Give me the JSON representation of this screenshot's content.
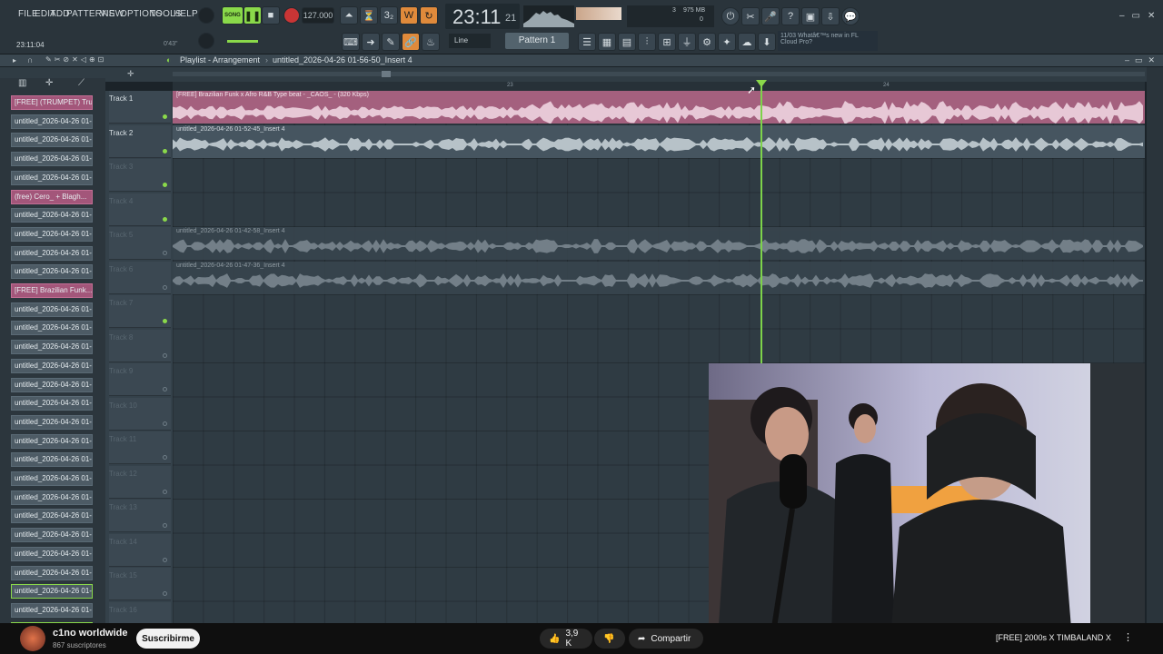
{
  "menu": [
    "FILE",
    "EDIT",
    "ADD",
    "PATTERNS",
    "VIEW",
    "OPTIONS",
    "TOOLS",
    "HELP"
  ],
  "transport": {
    "mode": "SONG",
    "tempo": "127.000",
    "clock": "23:11",
    "clock_small": "21",
    "time_readout": "23:11:04",
    "time_small": "0'43\""
  },
  "stats": {
    "cpu": "3",
    "mem": "975 MB",
    "poly": "0"
  },
  "snap": "Line",
  "pattern": "Pattern 1",
  "news": {
    "date": "11/03",
    "line1": "Whatâ€™s new in FL",
    "line2": "Cloud Pro?"
  },
  "breadcrumb": {
    "root": "Playlist - Arrangement",
    "project": "untitled_2026-04-26 01-56-50_Insert 4"
  },
  "ruler": {
    "m1": "23",
    "m2": "24"
  },
  "patterns": [
    {
      "label": "[FREE] (TRUMPET) Tru...",
      "style": "pink"
    },
    {
      "label": "untitled_2026-04-26 01-...",
      "style": ""
    },
    {
      "label": "untitled_2026-04-26 01-...",
      "style": ""
    },
    {
      "label": "untitled_2026-04-26 01-...",
      "style": ""
    },
    {
      "label": "untitled_2026-04-26 01-...",
      "style": ""
    },
    {
      "label": "(free) Cero_ + Blagh...",
      "style": "pink"
    },
    {
      "label": "untitled_2026-04-26 01-...",
      "style": ""
    },
    {
      "label": "untitled_2026-04-26 01-...",
      "style": ""
    },
    {
      "label": "untitled_2026-04-26 01-...",
      "style": ""
    },
    {
      "label": "untitled_2026-04-26 01-...",
      "style": ""
    },
    {
      "label": "[FREE] Brazilian Funk...",
      "style": "pink"
    },
    {
      "label": "untitled_2026-04-26 01-...",
      "style": ""
    },
    {
      "label": "untitled_2026-04-26 01-...",
      "style": ""
    },
    {
      "label": "untitled_2026-04-26 01-...",
      "style": ""
    },
    {
      "label": "untitled_2026-04-26 01-...",
      "style": ""
    },
    {
      "label": "untitled_2026-04-26 01-...",
      "style": ""
    },
    {
      "label": "untitled_2026-04-26 01-...",
      "style": ""
    },
    {
      "label": "untitled_2026-04-26 01-...",
      "style": ""
    },
    {
      "label": "untitled_2026-04-26 01-...",
      "style": ""
    },
    {
      "label": "untitled_2026-04-26 01-...",
      "style": ""
    },
    {
      "label": "untitled_2026-04-26 01-...",
      "style": ""
    },
    {
      "label": "untitled_2026-04-26 01-...",
      "style": ""
    },
    {
      "label": "untitled_2026-04-26 01-...",
      "style": ""
    },
    {
      "label": "untitled_2026-04-26 01-...",
      "style": ""
    },
    {
      "label": "untitled_2026-04-26 01-...",
      "style": ""
    },
    {
      "label": "untitled_2026-04-26 01-...",
      "style": ""
    },
    {
      "label": "untitled_2026-04-26 01-...",
      "style": "green"
    },
    {
      "label": "untitled_2026-04-26 01-...",
      "style": ""
    },
    {
      "label": "untitled_2026-04-26 01-...",
      "style": "green"
    }
  ],
  "tracks": [
    "Track 1",
    "Track 2",
    "Track 3",
    "Track 4",
    "Track 5",
    "Track 6",
    "Track 7",
    "Track 8",
    "Track 9",
    "Track 10",
    "Track 11",
    "Track 12",
    "Track 13",
    "Track 14",
    "Track 15",
    "Track 16"
  ],
  "clips": [
    {
      "label": "[FREE] Brazilian Funk x Afro R&B Type beat - _CAOS_ - (320 Kbps)",
      "track": 0,
      "color": "pink"
    },
    {
      "label": "untitled_2026-04-26 01-52-45_Insert 4",
      "track": 1,
      "color": "gray"
    },
    {
      "label": "untitled_2026-04-26 01-42-58_Insert 4",
      "track": 4,
      "color": "dim"
    },
    {
      "label": "untitled_2026-04-26 01-47-36_Insert 4",
      "track": 5,
      "color": "dim"
    }
  ],
  "youtube": {
    "channel": "c1no worldwide",
    "subs": "867 suscriptores",
    "subscribe": "Suscribirme",
    "likes": "3,9 K",
    "share": "Compartir",
    "now_playing": "[FREE] 2000s X TIMBALAND X"
  },
  "colors": {
    "accent": "#8ad94a",
    "orange": "#e08a3b",
    "pink": "#c46e98"
  }
}
